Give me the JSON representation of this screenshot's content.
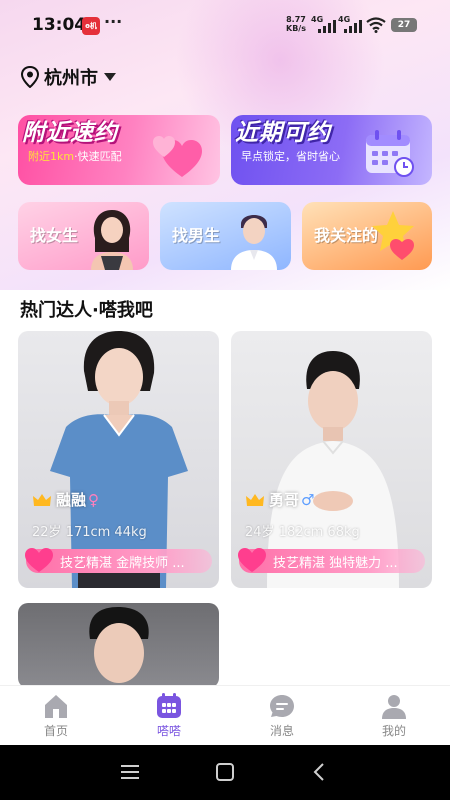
{
  "status_bar": {
    "time": "13:04",
    "app_badge": "ɵ机",
    "more": "···",
    "net_speed_value": "8.77",
    "net_speed_unit": "KB/s",
    "signal1": "4G",
    "signal2": "4G",
    "battery": "27"
  },
  "location": {
    "city": "杭州市"
  },
  "banners": [
    {
      "title": "附近速约",
      "sub_highlight": "附近1km",
      "sub_rest": "·快速匹配"
    },
    {
      "title": "近期可约",
      "sub": "早点锁定，省时省心"
    }
  ],
  "categories": [
    {
      "label": "找女生"
    },
    {
      "label": "找男生"
    },
    {
      "label": "我关注的"
    }
  ],
  "section_title": "热门达人·嗒我吧",
  "profiles": [
    {
      "name": "融融",
      "gender": "♀",
      "stats": "22岁 171cm 44kg",
      "tag": "技艺精湛 金牌技师 ..."
    },
    {
      "name": "勇哥",
      "gender": "♂",
      "stats": "24岁 182cm 68kg",
      "tag": "技艺精湛 独特魅力 ..."
    },
    {
      "name": "",
      "gender": "",
      "stats": "",
      "tag": ""
    }
  ],
  "bottom_nav": [
    {
      "label": "首页",
      "icon": "home-icon",
      "active": false
    },
    {
      "label": "嗒嗒",
      "icon": "grid-icon",
      "active": true
    },
    {
      "label": "消息",
      "icon": "message-icon",
      "active": false
    },
    {
      "label": "我的",
      "icon": "person-icon",
      "active": false
    }
  ],
  "colors": {
    "accent": "#7a55e0",
    "pink": "#ff4fa3",
    "purple": "#6f51f0"
  }
}
